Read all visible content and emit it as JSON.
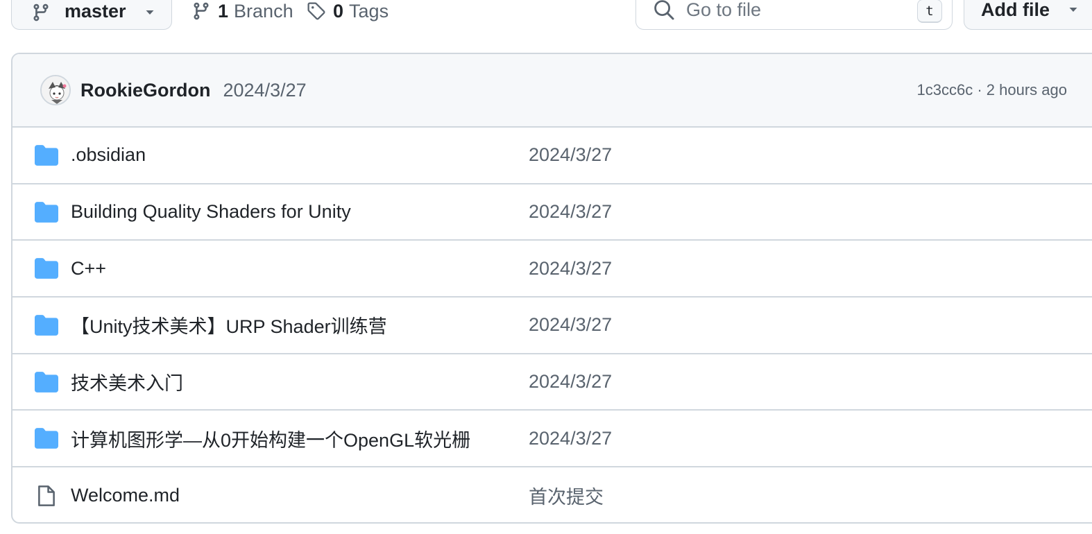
{
  "toolbar": {
    "branch_name": "master",
    "branches_count": "1",
    "branches_label": "Branch",
    "tags_count": "0",
    "tags_label": "Tags",
    "search_placeholder": "Go to file",
    "search_shortcut": "t",
    "add_file_label": "Add file"
  },
  "latest_commit": {
    "author": "RookieGordon",
    "message": "2024/3/27",
    "sha_and_time": "1c3cc6c · 2 hours ago"
  },
  "files": [
    {
      "type": "folder",
      "icon": "folder-icon",
      "name": ".obsidian",
      "commit_message": "2024/3/27"
    },
    {
      "type": "folder",
      "icon": "folder-icon",
      "name": "Building Quality Shaders for Unity",
      "commit_message": "2024/3/27"
    },
    {
      "type": "folder",
      "icon": "folder-icon",
      "name": "C++",
      "commit_message": "2024/3/27"
    },
    {
      "type": "folder",
      "icon": "folder-icon",
      "name": "【Unity技术美术】URP Shader训练营",
      "commit_message": "2024/3/27"
    },
    {
      "type": "folder",
      "icon": "folder-icon",
      "name": "技术美术入门",
      "commit_message": "2024/3/27"
    },
    {
      "type": "folder",
      "icon": "folder-icon",
      "name": "计算机图形学—从0开始构建一个OpenGL软光栅",
      "commit_message": "2024/3/27"
    },
    {
      "type": "file",
      "icon": "file-icon",
      "name": "Welcome.md",
      "commit_message": "首次提交"
    }
  ],
  "colors": {
    "folder": "#54aeff",
    "border": "#d0d7de",
    "muted_text": "#59636e",
    "header_bg": "#f6f8fa"
  }
}
